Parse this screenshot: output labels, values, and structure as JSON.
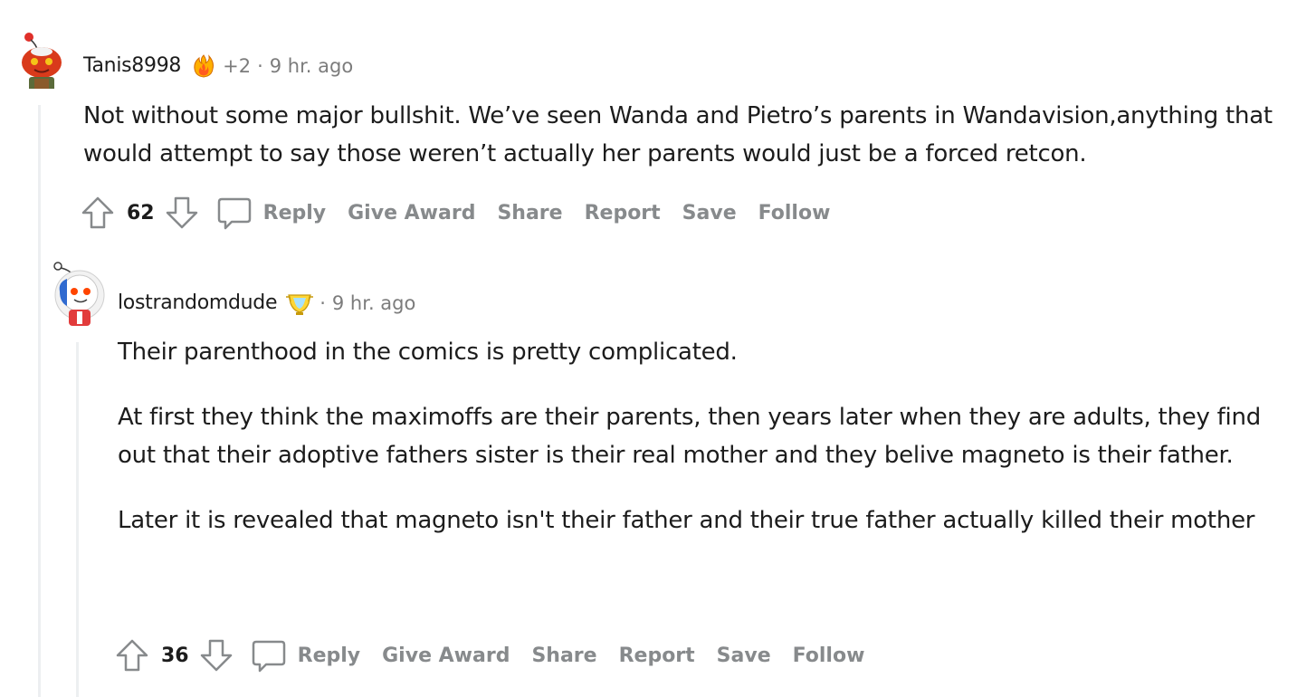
{
  "comments": [
    {
      "username": "Tanis8998",
      "flair_icon": "flame-award-icon",
      "karma": "+2",
      "separator": "·",
      "time": "9 hr. ago",
      "paragraphs": [
        "Not without some major bullshit. We’ve seen Wanda and Pietro’s parents in Wandavision,anything that would attempt to say those weren’t actually her parents would just be a forced retcon."
      ],
      "score": "62",
      "actions": {
        "reply": "Reply",
        "give_award": "Give Award",
        "share": "Share",
        "report": "Report",
        "save": "Save",
        "follow": "Follow"
      }
    },
    {
      "username": "lostrandomdude",
      "flair_icon": "trophy-award-icon",
      "separator": "·",
      "time": "9 hr. ago",
      "paragraphs": [
        "Their parenthood in the comics is pretty complicated.",
        "At first they think the maximoffs are their parents, then years later when they are adults, they find out that their adoptive fathers sister is their real mother and they belive magneto is their father.",
        "Later it is revealed that magneto isn't their father and their true father actually killed their mother"
      ],
      "score": "36",
      "actions": {
        "reply": "Reply",
        "give_award": "Give Award",
        "share": "Share",
        "report": "Report",
        "save": "Save",
        "follow": "Follow"
      }
    }
  ],
  "colors": {
    "text": "#1c1c1c",
    "muted": "#7c7c7c",
    "action": "#878a8c",
    "thread_line": "#edeff1"
  }
}
